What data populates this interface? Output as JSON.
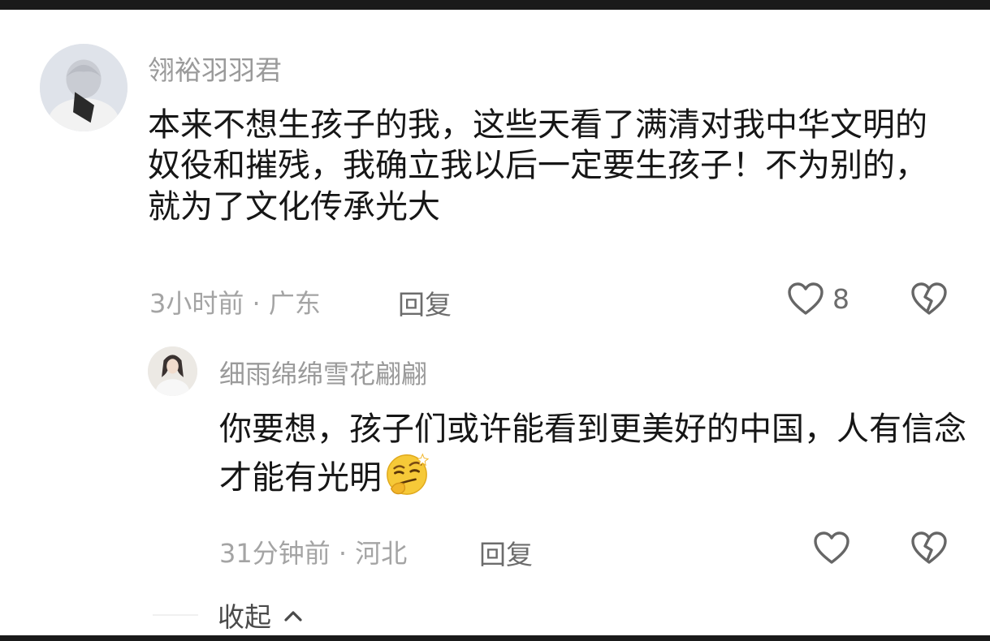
{
  "comment": {
    "username": "翎裕羽羽君",
    "text": "本来不想生孩子的我，这些天看了满清对我中华文明的奴役和摧残，我确立我以后一定要生孩子！不为别的，就为了文化传承光大",
    "meta": "3小时前 · 广东",
    "reply_label": "回复",
    "like_count": "8"
  },
  "reply": {
    "username": "细雨绵绵雪花翩翩",
    "text": "你要想，孩子们或许能看到更美好的中国，人有信念才能有光明",
    "emoji": "smirk-emoji",
    "meta": "31分钟前 · 河北",
    "reply_label": "回复"
  },
  "collapse_label": "收起",
  "colors": {
    "text_primary": "#161616",
    "text_secondary": "#9a9a9a",
    "icon": "#666666",
    "frame": "#1a1a1a"
  }
}
